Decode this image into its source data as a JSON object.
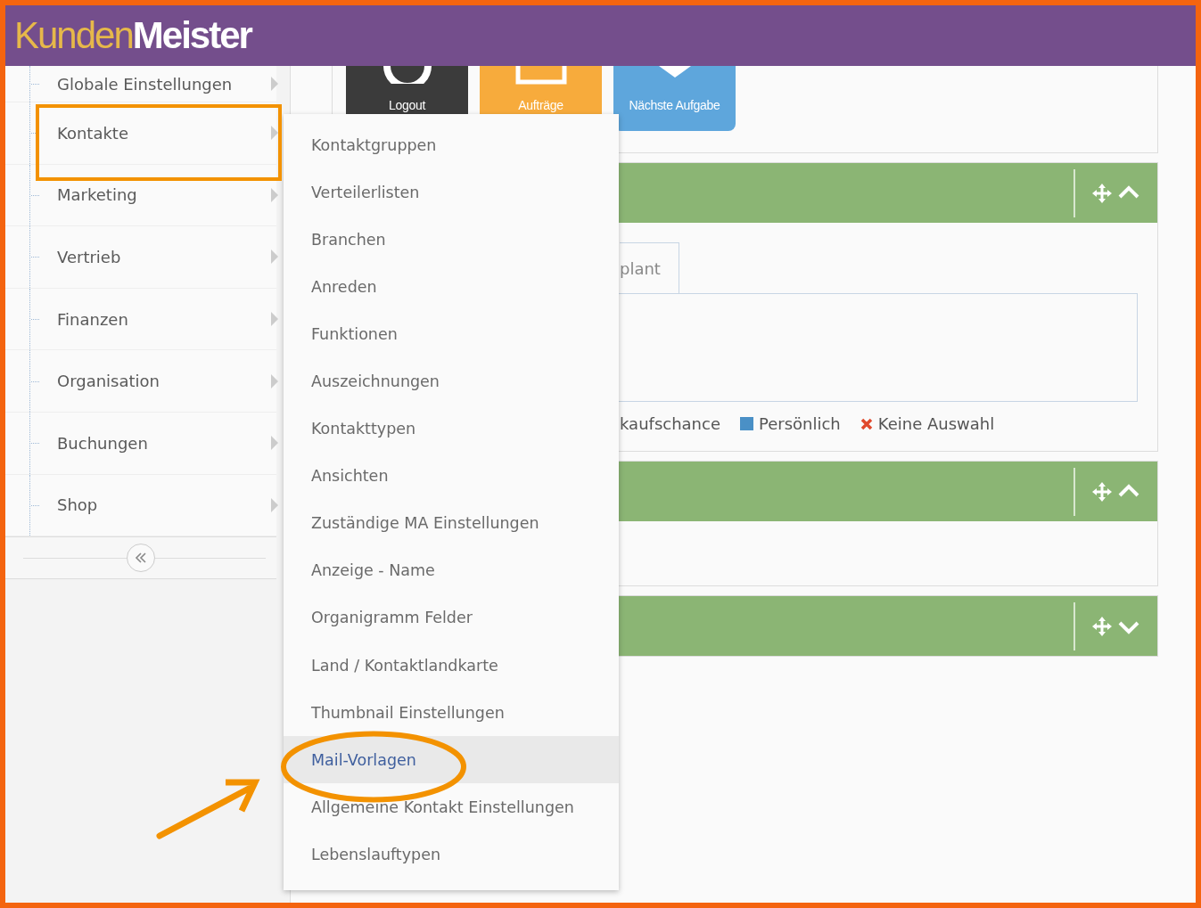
{
  "logo": {
    "light": "Kunden",
    "bold": "Meister"
  },
  "sidebar": {
    "items": [
      {
        "label": "Globale Einstellungen",
        "selected": false
      },
      {
        "label": "Kontakte",
        "selected": true
      },
      {
        "label": "Marketing",
        "selected": false
      },
      {
        "label": "Vertrieb",
        "selected": false
      },
      {
        "label": "Finanzen",
        "selected": false
      },
      {
        "label": "Organisation",
        "selected": false
      },
      {
        "label": "Buchungen",
        "selected": false
      },
      {
        "label": "Shop",
        "selected": false
      }
    ]
  },
  "tiles": [
    {
      "label": "Logout",
      "kind": "power",
      "color": "#3b3b3b"
    },
    {
      "label": "Aufträge",
      "kind": "document",
      "color": "#f7ab3c"
    },
    {
      "label": "Nächste Aufgabe",
      "kind": "chevron",
      "color": "#5ea6dc"
    }
  ],
  "panels": [
    {
      "expanded": true,
      "tabs": [
        {
          "label": "plant"
        }
      ],
      "legend": [
        {
          "label": "kaufschance",
          "kind": "text"
        },
        {
          "label": "Persönlich",
          "kind": "square",
          "color": "#4a90c6"
        },
        {
          "label": "Keine Auswahl",
          "kind": "cross",
          "color": "#e0492c"
        }
      ]
    },
    {
      "expanded": true
    },
    {
      "expanded": false
    }
  ],
  "submenu": {
    "items": [
      {
        "label": "Kontaktgruppen",
        "selected": false
      },
      {
        "label": "Verteilerlisten",
        "selected": false
      },
      {
        "label": "Branchen",
        "selected": false
      },
      {
        "label": "Anreden",
        "selected": false
      },
      {
        "label": "Funktionen",
        "selected": false
      },
      {
        "label": "Auszeichnungen",
        "selected": false
      },
      {
        "label": "Kontakttypen",
        "selected": false
      },
      {
        "label": "Ansichten",
        "selected": false
      },
      {
        "label": "Zuständige MA Einstellungen",
        "selected": false
      },
      {
        "label": "Anzeige - Name",
        "selected": false
      },
      {
        "label": "Organigramm Felder",
        "selected": false
      },
      {
        "label": "Land / Kontaktlandkarte",
        "selected": false
      },
      {
        "label": "Thumbnail Einstellungen",
        "selected": false
      },
      {
        "label": "Mail-Vorlagen",
        "selected": true
      },
      {
        "label": "Allgemeine Kontakt Einstellungen",
        "selected": false
      },
      {
        "label": "Lebenslauftypen",
        "selected": false
      }
    ]
  }
}
